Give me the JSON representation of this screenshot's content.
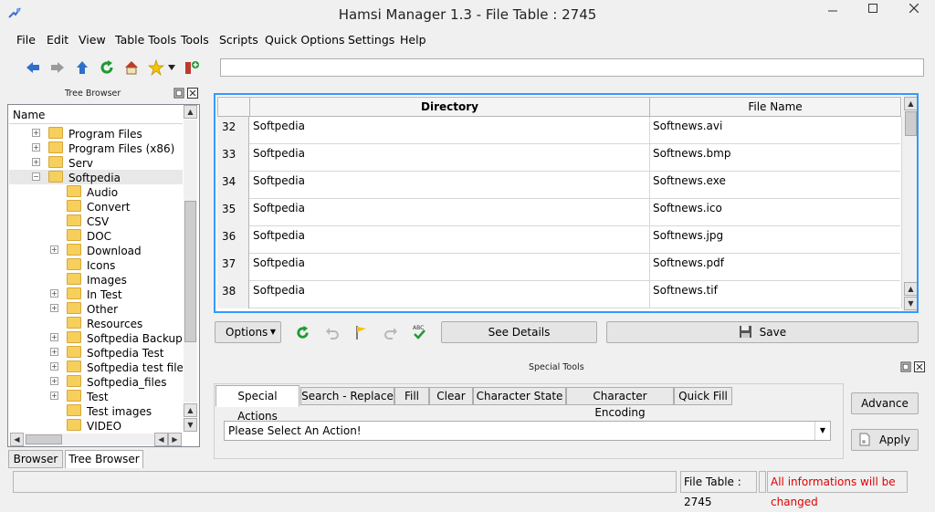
{
  "window": {
    "title": "Hamsi Manager 1.3 - File Table : 2745"
  },
  "menu": [
    "File",
    "Edit",
    "View",
    "Table Tools",
    "Tools",
    "Scripts",
    "Quick Options",
    "Settings",
    "Help"
  ],
  "toolbar": {
    "icons": [
      "back-arrow-icon",
      "forward-arrow-icon",
      "up-arrow-icon",
      "refresh-icon",
      "home-icon",
      "star-icon",
      "bookmark-add-icon"
    ],
    "address_value": ""
  },
  "tree_browser": {
    "title": "Tree Browser",
    "column_header": "Name",
    "items": [
      {
        "label": "Program Files",
        "level": 1,
        "expandable": true
      },
      {
        "label": "Program Files (x86)",
        "level": 1,
        "expandable": true
      },
      {
        "label": "Serv",
        "level": 1,
        "expandable": true
      },
      {
        "label": "Softpedia",
        "level": 1,
        "expandable": true,
        "expanded": true,
        "selected": true
      },
      {
        "label": "Audio",
        "level": 2,
        "expandable": false
      },
      {
        "label": "Convert",
        "level": 2,
        "expandable": false
      },
      {
        "label": "CSV",
        "level": 2,
        "expandable": false
      },
      {
        "label": "DOC",
        "level": 2,
        "expandable": false
      },
      {
        "label": "Download",
        "level": 2,
        "expandable": true
      },
      {
        "label": "Icons",
        "level": 2,
        "expandable": false
      },
      {
        "label": "Images",
        "level": 2,
        "expandable": false
      },
      {
        "label": "In Test",
        "level": 2,
        "expandable": true
      },
      {
        "label": "Other",
        "level": 2,
        "expandable": true
      },
      {
        "label": "Resources",
        "level": 2,
        "expandable": false
      },
      {
        "label": "Softpedia Backup",
        "level": 2,
        "expandable": true
      },
      {
        "label": "Softpedia Test",
        "level": 2,
        "expandable": true
      },
      {
        "label": "Softpedia test files",
        "level": 2,
        "expandable": true
      },
      {
        "label": "Softpedia_files",
        "level": 2,
        "expandable": true
      },
      {
        "label": "Test",
        "level": 2,
        "expandable": true
      },
      {
        "label": "Test images",
        "level": 2,
        "expandable": false
      },
      {
        "label": "VIDEO",
        "level": 2,
        "expandable": false
      }
    ],
    "bottom_tabs": [
      "Browser",
      "Tree Browser"
    ]
  },
  "file_table": {
    "columns": [
      "Directory",
      "File Name"
    ],
    "rows": [
      {
        "num": "32",
        "directory": "Softpedia",
        "file": "Softnews.avi"
      },
      {
        "num": "33",
        "directory": "Softpedia",
        "file": "Softnews.bmp"
      },
      {
        "num": "34",
        "directory": "Softpedia",
        "file": "Softnews.exe"
      },
      {
        "num": "35",
        "directory": "Softpedia",
        "file": "Softnews.ico"
      },
      {
        "num": "36",
        "directory": "Softpedia",
        "file": "Softnews.jpg"
      },
      {
        "num": "37",
        "directory": "Softpedia",
        "file": "Softnews.pdf"
      },
      {
        "num": "38",
        "directory": "Softpedia",
        "file": "Softnews.tif"
      }
    ]
  },
  "table_actions": {
    "options_label": "Options",
    "see_details_label": "See Details",
    "save_label": "Save"
  },
  "special_tools": {
    "title": "Special Tools",
    "tabs": [
      "Special Actions",
      "Search - Replace",
      "Fill",
      "Clear",
      "Character State",
      "Character Encoding",
      "Quick Fill"
    ],
    "action_select_value": "Please Select An Action!",
    "advance_label": "Advance",
    "apply_label": "Apply"
  },
  "status_bar": {
    "file_table_label": "File Table : 2745",
    "warning": "All informations will be changed",
    "warning_color": "#e00000"
  }
}
